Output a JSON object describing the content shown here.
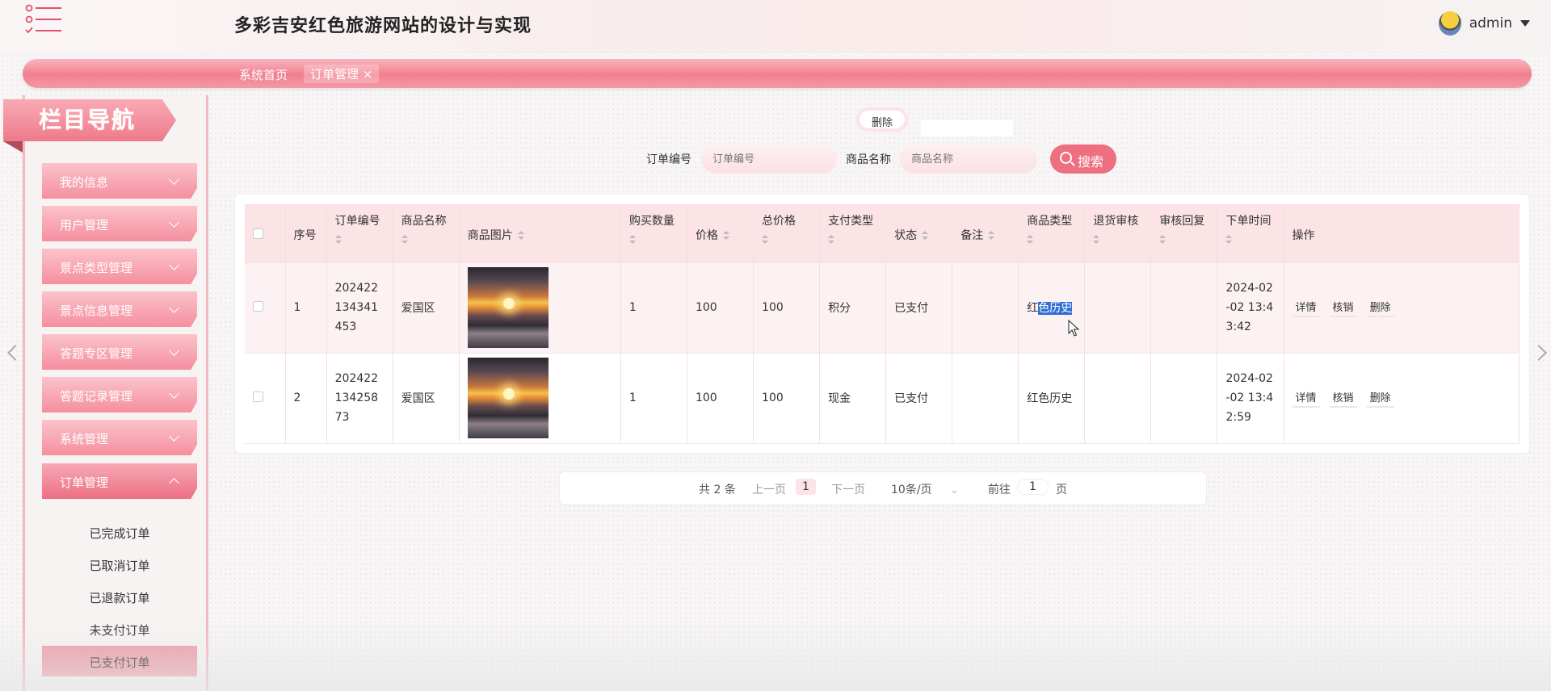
{
  "header": {
    "title": "多彩吉安红色旅游网站的设计与实现",
    "username": "admin"
  },
  "tabs": {
    "home": "系统首页",
    "active": "订单管理 ×"
  },
  "sidebar": {
    "title": "栏目导航",
    "items": [
      {
        "label": "我的信息"
      },
      {
        "label": "用户管理"
      },
      {
        "label": "景点类型管理"
      },
      {
        "label": "景点信息管理"
      },
      {
        "label": "答题专区管理"
      },
      {
        "label": "答题记录管理"
      },
      {
        "label": "系统管理"
      },
      {
        "label": "订单管理"
      }
    ],
    "sub_items": [
      {
        "label": "已完成订单"
      },
      {
        "label": "已取消订单"
      },
      {
        "label": "已退款订单"
      },
      {
        "label": "未支付订单"
      },
      {
        "label": "已支付订单"
      }
    ]
  },
  "toolbar": {
    "delete_label": "删除",
    "order_no_label": "订单编号",
    "order_no_placeholder": "订单编号",
    "product_name_label": "商品名称",
    "product_name_placeholder": "商品名称",
    "search_label": "搜索"
  },
  "table": {
    "headers": {
      "index": "序号",
      "order_no": "订单编号",
      "product_name": "商品名称",
      "product_image": "商品图片",
      "quantity": "购买数量",
      "price": "价格",
      "total": "总价格",
      "pay_type": "支付类型",
      "status": "状态",
      "remark": "备注",
      "product_type": "商品类型",
      "refund_review": "退货审核",
      "review_reply": "审核回复",
      "order_time": "下单时间",
      "actions": "操作"
    },
    "rows": [
      {
        "index": "1",
        "order_no": "202422134341453",
        "product_name": "爱国区",
        "quantity": "1",
        "price": "100",
        "total": "100",
        "pay_type": "积分",
        "status": "已支付",
        "remark": "",
        "product_type_prefix": "红",
        "product_type_highlight": "色历史",
        "refund_review": "",
        "review_reply": "",
        "order_time": "2024-02-02 13:43:42"
      },
      {
        "index": "2",
        "order_no": "202422134258 73",
        "product_name": "爱国区",
        "quantity": "1",
        "price": "100",
        "total": "100",
        "pay_type": "现金",
        "status": "已支付",
        "remark": "",
        "product_type": "红色历史",
        "refund_review": "",
        "review_reply": "",
        "order_time": "2024-02-02 13:42:59"
      }
    ],
    "actions": {
      "detail": "详情",
      "verify": "核销",
      "delete": "删除"
    }
  },
  "pagination": {
    "total": "共 2 条",
    "prev": "上一页",
    "current": "1",
    "next": "下一页",
    "page_size": "10条/页",
    "goto_label": "前往",
    "goto_value": "1",
    "page_unit": "页"
  },
  "colors": {
    "accent": "#ee6f80",
    "tab_bar": "#f17f8e",
    "highlight": "#2f6fd6"
  }
}
